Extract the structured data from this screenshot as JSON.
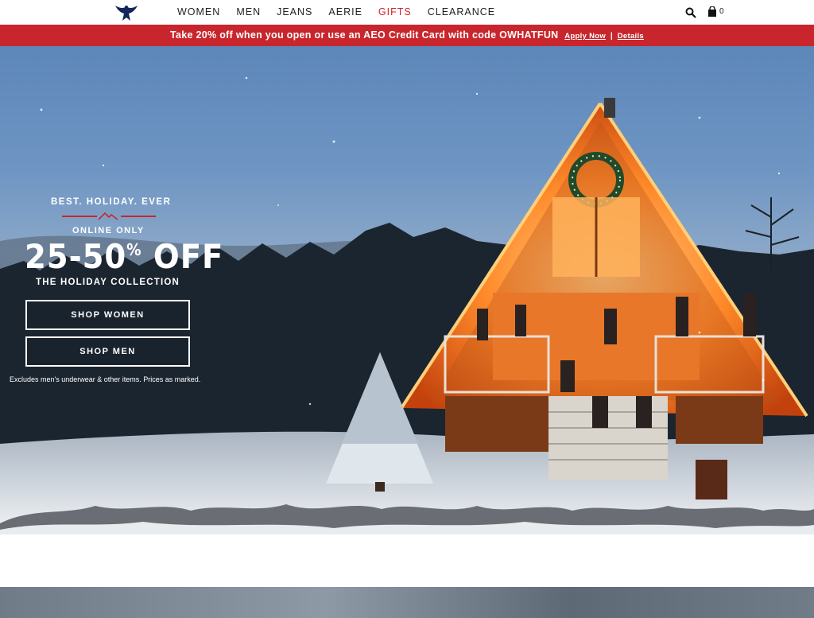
{
  "header": {
    "logo": "eagle-logo",
    "nav": [
      {
        "label": "WOMEN"
      },
      {
        "label": "MEN"
      },
      {
        "label": "JEANS"
      },
      {
        "label": "AERIE"
      },
      {
        "label": "GIFTS"
      },
      {
        "label": "CLEARANCE"
      }
    ],
    "bag_count": "0"
  },
  "promo": {
    "text": "Take 20% off when you open or use an AEO Credit Card with code OWHATFUN",
    "apply_label": "Apply Now",
    "separator": "|",
    "details_label": "Details",
    "bg_color": "#c8262c"
  },
  "hero": {
    "eyebrow": "BEST. HOLIDAY. EVER",
    "online": "ONLINE ONLY",
    "discount": "25-50",
    "discount_sup": "%",
    "discount_suffix": "OFF",
    "collection": "THE HOLIDAY COLLECTION",
    "shop_women": "SHOP WOMEN",
    "shop_men": "SHOP MEN",
    "disclaimer": "Excludes men's underwear & other items. Prices as marked."
  },
  "colors": {
    "accent_red": "#d2232a",
    "sky": "#6e95c3",
    "cabin_glow": "#ff7a1a"
  }
}
